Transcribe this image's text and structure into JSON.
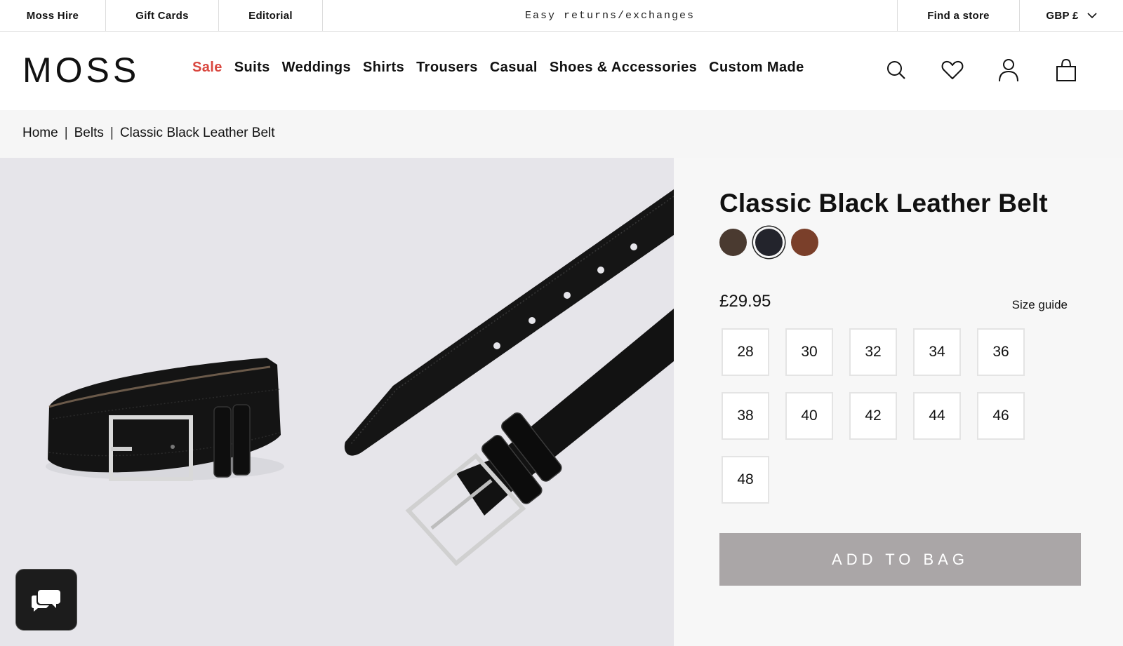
{
  "utility_bar": {
    "links": [
      "Moss Hire",
      "Gift Cards",
      "Editorial"
    ],
    "promo": "Easy returns/exchanges",
    "find_store": "Find a store",
    "currency": "GBP £"
  },
  "header": {
    "logo": "MOSS",
    "nav": [
      "Sale",
      "Suits",
      "Weddings",
      "Shirts",
      "Trousers",
      "Casual",
      "Shoes & Accessories",
      "Custom Made"
    ],
    "icons": [
      "search-icon",
      "heart-icon",
      "account-icon",
      "bag-icon"
    ]
  },
  "breadcrumb": [
    "Home",
    "Belts",
    "Classic Black Leather Belt"
  ],
  "breadcrumb_separator": "|",
  "product": {
    "title": "Classic Black Leather Belt",
    "swatches": [
      {
        "name": "brown",
        "color": "#4a3a30"
      },
      {
        "name": "black",
        "color": "#23242c",
        "selected": true
      },
      {
        "name": "tan",
        "color": "#7a3f2a"
      }
    ],
    "price": "£29.95",
    "size_guide": "Size guide",
    "sizes": [
      "28",
      "30",
      "32",
      "34",
      "36",
      "38",
      "40",
      "42",
      "44",
      "46",
      "48"
    ],
    "add_to_bag": "ADD TO BAG"
  },
  "colors": {
    "sale_red": "#d9473f",
    "button_grey": "#aaa6a7",
    "gallery_bg": "#e6e5ea"
  }
}
